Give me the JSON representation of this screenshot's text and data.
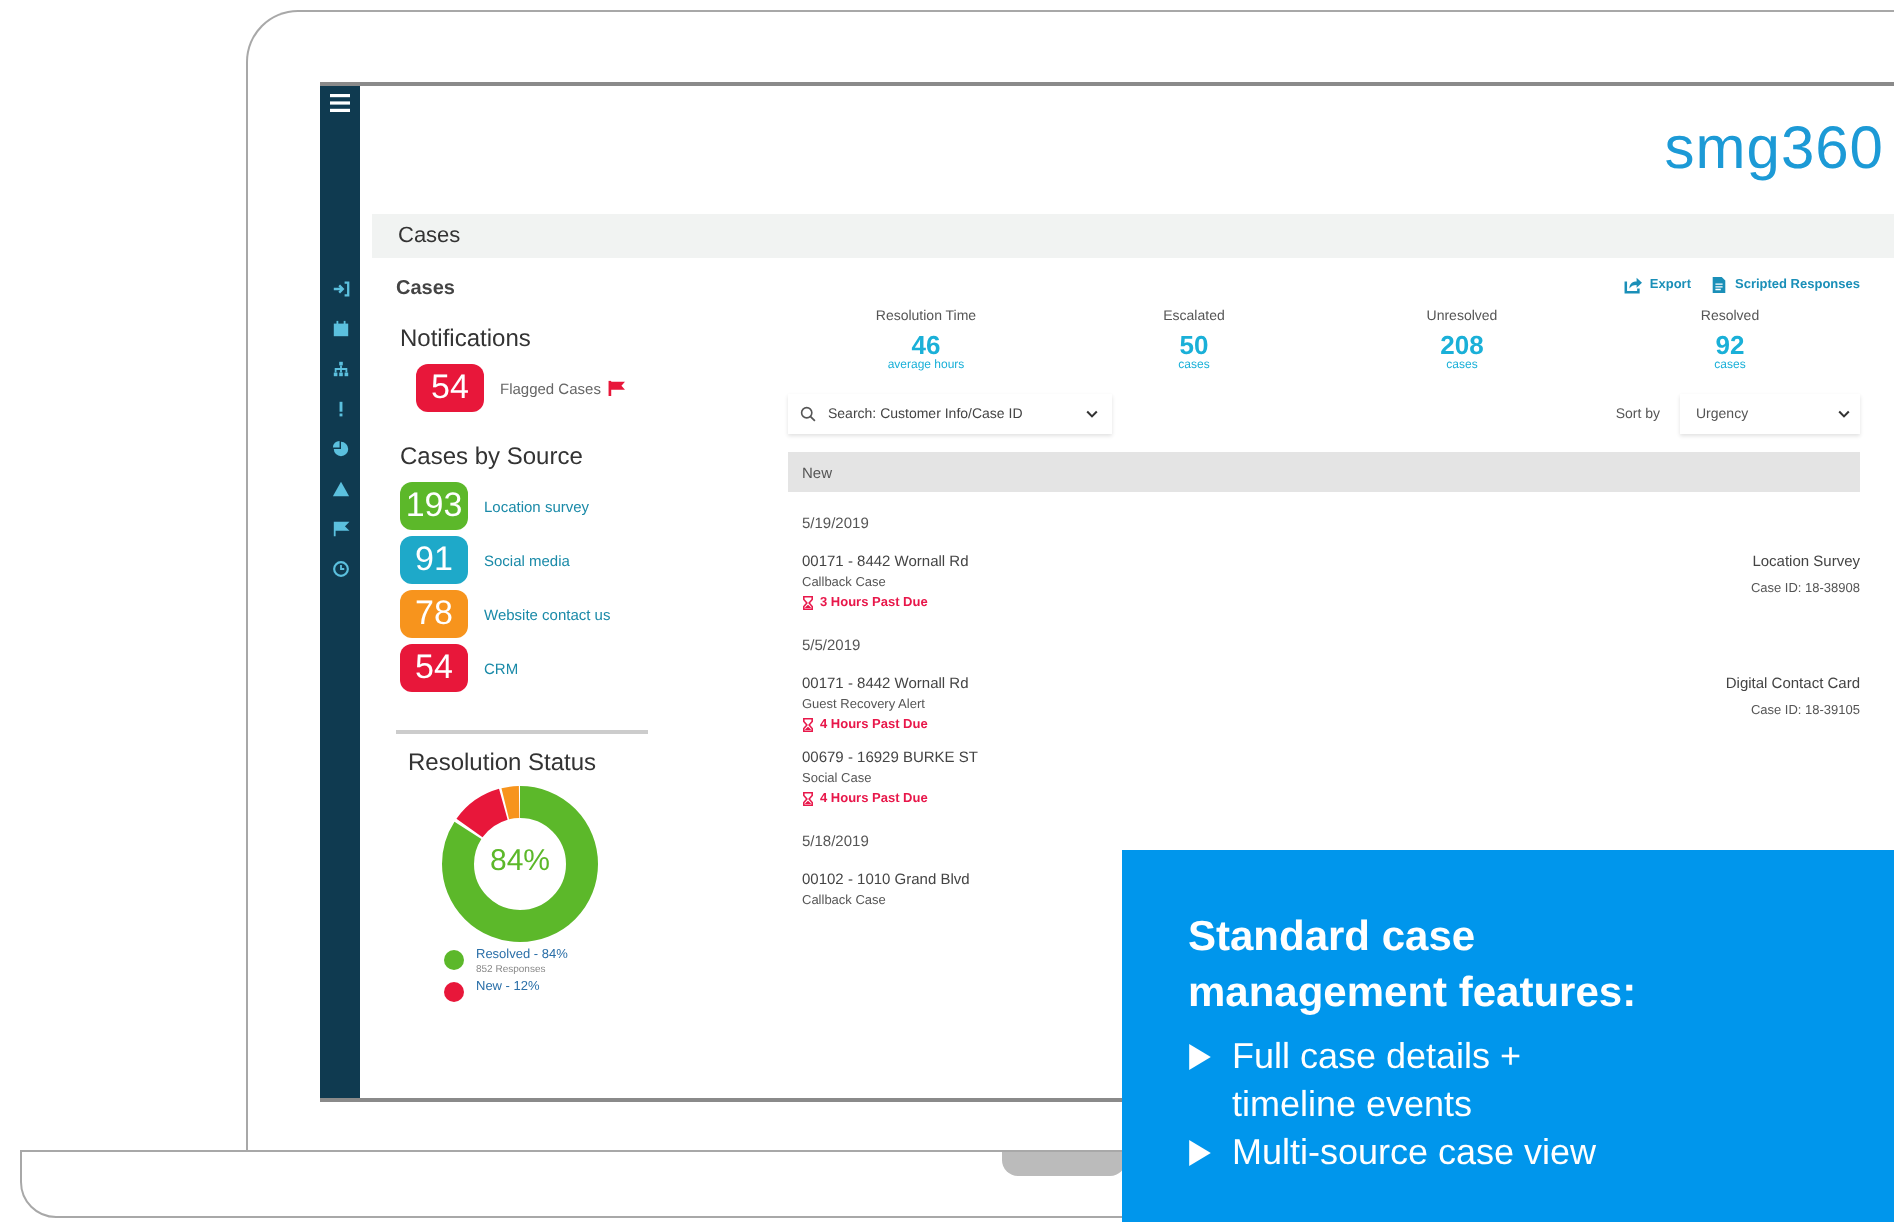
{
  "logo": "smg360",
  "page_title": "Cases",
  "card_title": "Cases",
  "notifications": {
    "title": "Notifications",
    "items": [
      {
        "count": "54",
        "label": "Flagged Cases",
        "color": "#e8173a"
      }
    ]
  },
  "sources": {
    "title": "Cases by Source",
    "items": [
      {
        "count": "193",
        "label": "Location survey",
        "color": "#5cb82a"
      },
      {
        "count": "91",
        "label": "Social media",
        "color": "#1ea9c9"
      },
      {
        "count": "78",
        "label": "Website contact us",
        "color": "#f7941d"
      },
      {
        "count": "54",
        "label": "CRM",
        "color": "#e8173a"
      }
    ]
  },
  "resolution_status": {
    "title": "Resolution Status",
    "center": "84%",
    "legend": [
      {
        "label": "Resolved - 84%",
        "sub": "852 Responses",
        "color": "#5cb82a"
      },
      {
        "label": "New - 12%",
        "color": "#e8173a"
      }
    ]
  },
  "actions": [
    {
      "kind": "export",
      "label": "Export"
    },
    {
      "kind": "document",
      "label": "Scripted Responses"
    }
  ],
  "stats": [
    {
      "label": "Resolution Time",
      "value": "46",
      "unit": "average hours"
    },
    {
      "label": "Escalated",
      "value": "50",
      "unit": "cases"
    },
    {
      "label": "Unresolved",
      "value": "208",
      "unit": "cases"
    },
    {
      "label": "Resolved",
      "value": "92",
      "unit": "cases"
    }
  ],
  "search": {
    "placeholder": "Search: Customer Info/Case ID"
  },
  "sort": {
    "label": "Sort by",
    "value": "Urgency"
  },
  "group": "New",
  "list": [
    {
      "kind": "date",
      "text": "5/19/2019"
    },
    {
      "kind": "case",
      "title": "00171 - 8442 Wornall Rd",
      "type": "Callback Case",
      "due": "3 Hours Past Due",
      "source": "Location Survey",
      "case_id": "Case ID: 18-38908"
    },
    {
      "kind": "date",
      "text": "5/5/2019"
    },
    {
      "kind": "case",
      "title": "00171 - 8442 Wornall Rd",
      "type": "Guest Recovery Alert",
      "due": "4 Hours Past Due",
      "source": "Digital Contact Card",
      "case_id": "Case ID: 18-39105"
    },
    {
      "kind": "case",
      "title": "00679 - 16929 BURKE ST",
      "type": "Social Case",
      "due": "4 Hours Past Due"
    },
    {
      "kind": "date",
      "text": "5/18/2019"
    },
    {
      "kind": "case",
      "title": "00102 - 1010 Grand Blvd",
      "type": "Callback Case"
    }
  ],
  "promo": {
    "title": "Standard case management features:",
    "bullets": [
      "Full case details + timeline events",
      "Multi-source case view"
    ]
  }
}
